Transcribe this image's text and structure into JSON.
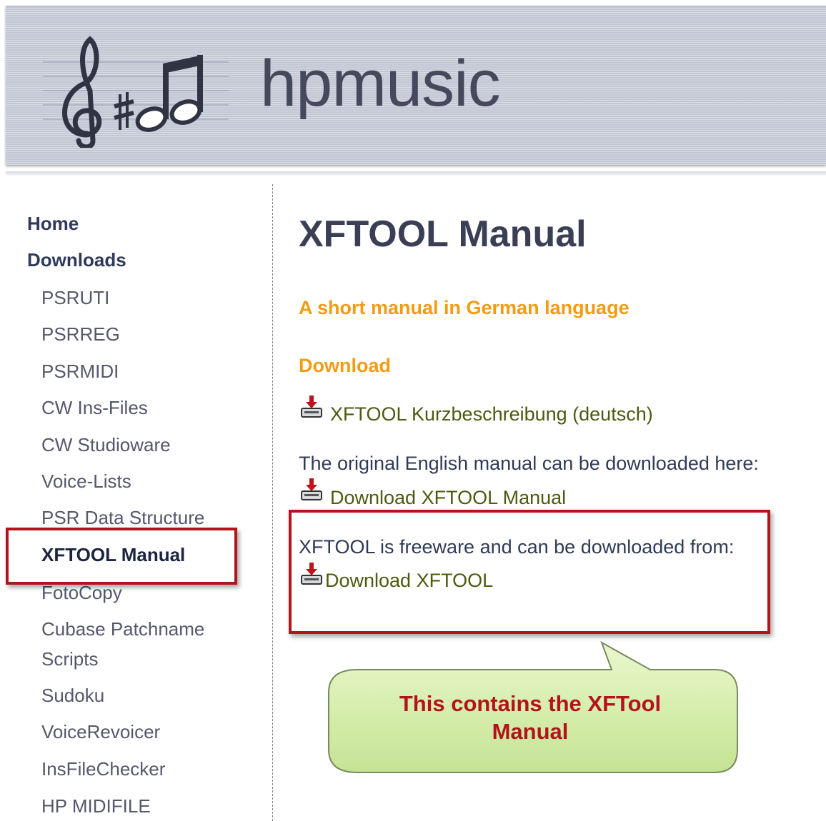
{
  "site": {
    "name": "hpmusic"
  },
  "nav": {
    "top": [
      {
        "label": "Home"
      },
      {
        "label": "Downloads"
      }
    ],
    "sub": [
      {
        "label": "PSRUTI"
      },
      {
        "label": "PSRREG"
      },
      {
        "label": "PSRMIDI"
      },
      {
        "label": "CW Ins-Files"
      },
      {
        "label": "CW Studioware"
      },
      {
        "label": "Voice-Lists"
      },
      {
        "label": "PSR Data Structure"
      },
      {
        "label": "XFTOOL Manual"
      },
      {
        "label": "FotoCopy"
      },
      {
        "label": "Cubase Patchname"
      },
      {
        "label": "Scripts"
      },
      {
        "label": "Sudoku"
      },
      {
        "label": "VoiceRevoicer"
      },
      {
        "label": "InsFileChecker"
      },
      {
        "label": "HP MIDIFILE"
      }
    ],
    "active": "XFTOOL Manual"
  },
  "main": {
    "title": "XFTOOL Manual",
    "subtitle": "A short manual in German language",
    "download_heading": "Download",
    "german_link": "XFTOOL Kurzbeschreibung (deutsch)",
    "english_intro": "The original English manual can be downloaded here:",
    "english_link": "Download XFTOOL Manual",
    "freeware_intro": "XFTOOL is freeware and can be downloaded from:",
    "freeware_link": "Download XFTOOL"
  },
  "annotation": {
    "callout_line1": "This contains the XFTool",
    "callout_line2": "Manual"
  },
  "colors": {
    "accent_orange": "#f39c12",
    "highlight_red": "#b3131b",
    "link_olive": "#4d5a10",
    "callout_green": "#d9efb0"
  },
  "icons": [
    "treble-clef-icon",
    "sharp-icon",
    "eighth-notes-icon",
    "download-icon"
  ]
}
